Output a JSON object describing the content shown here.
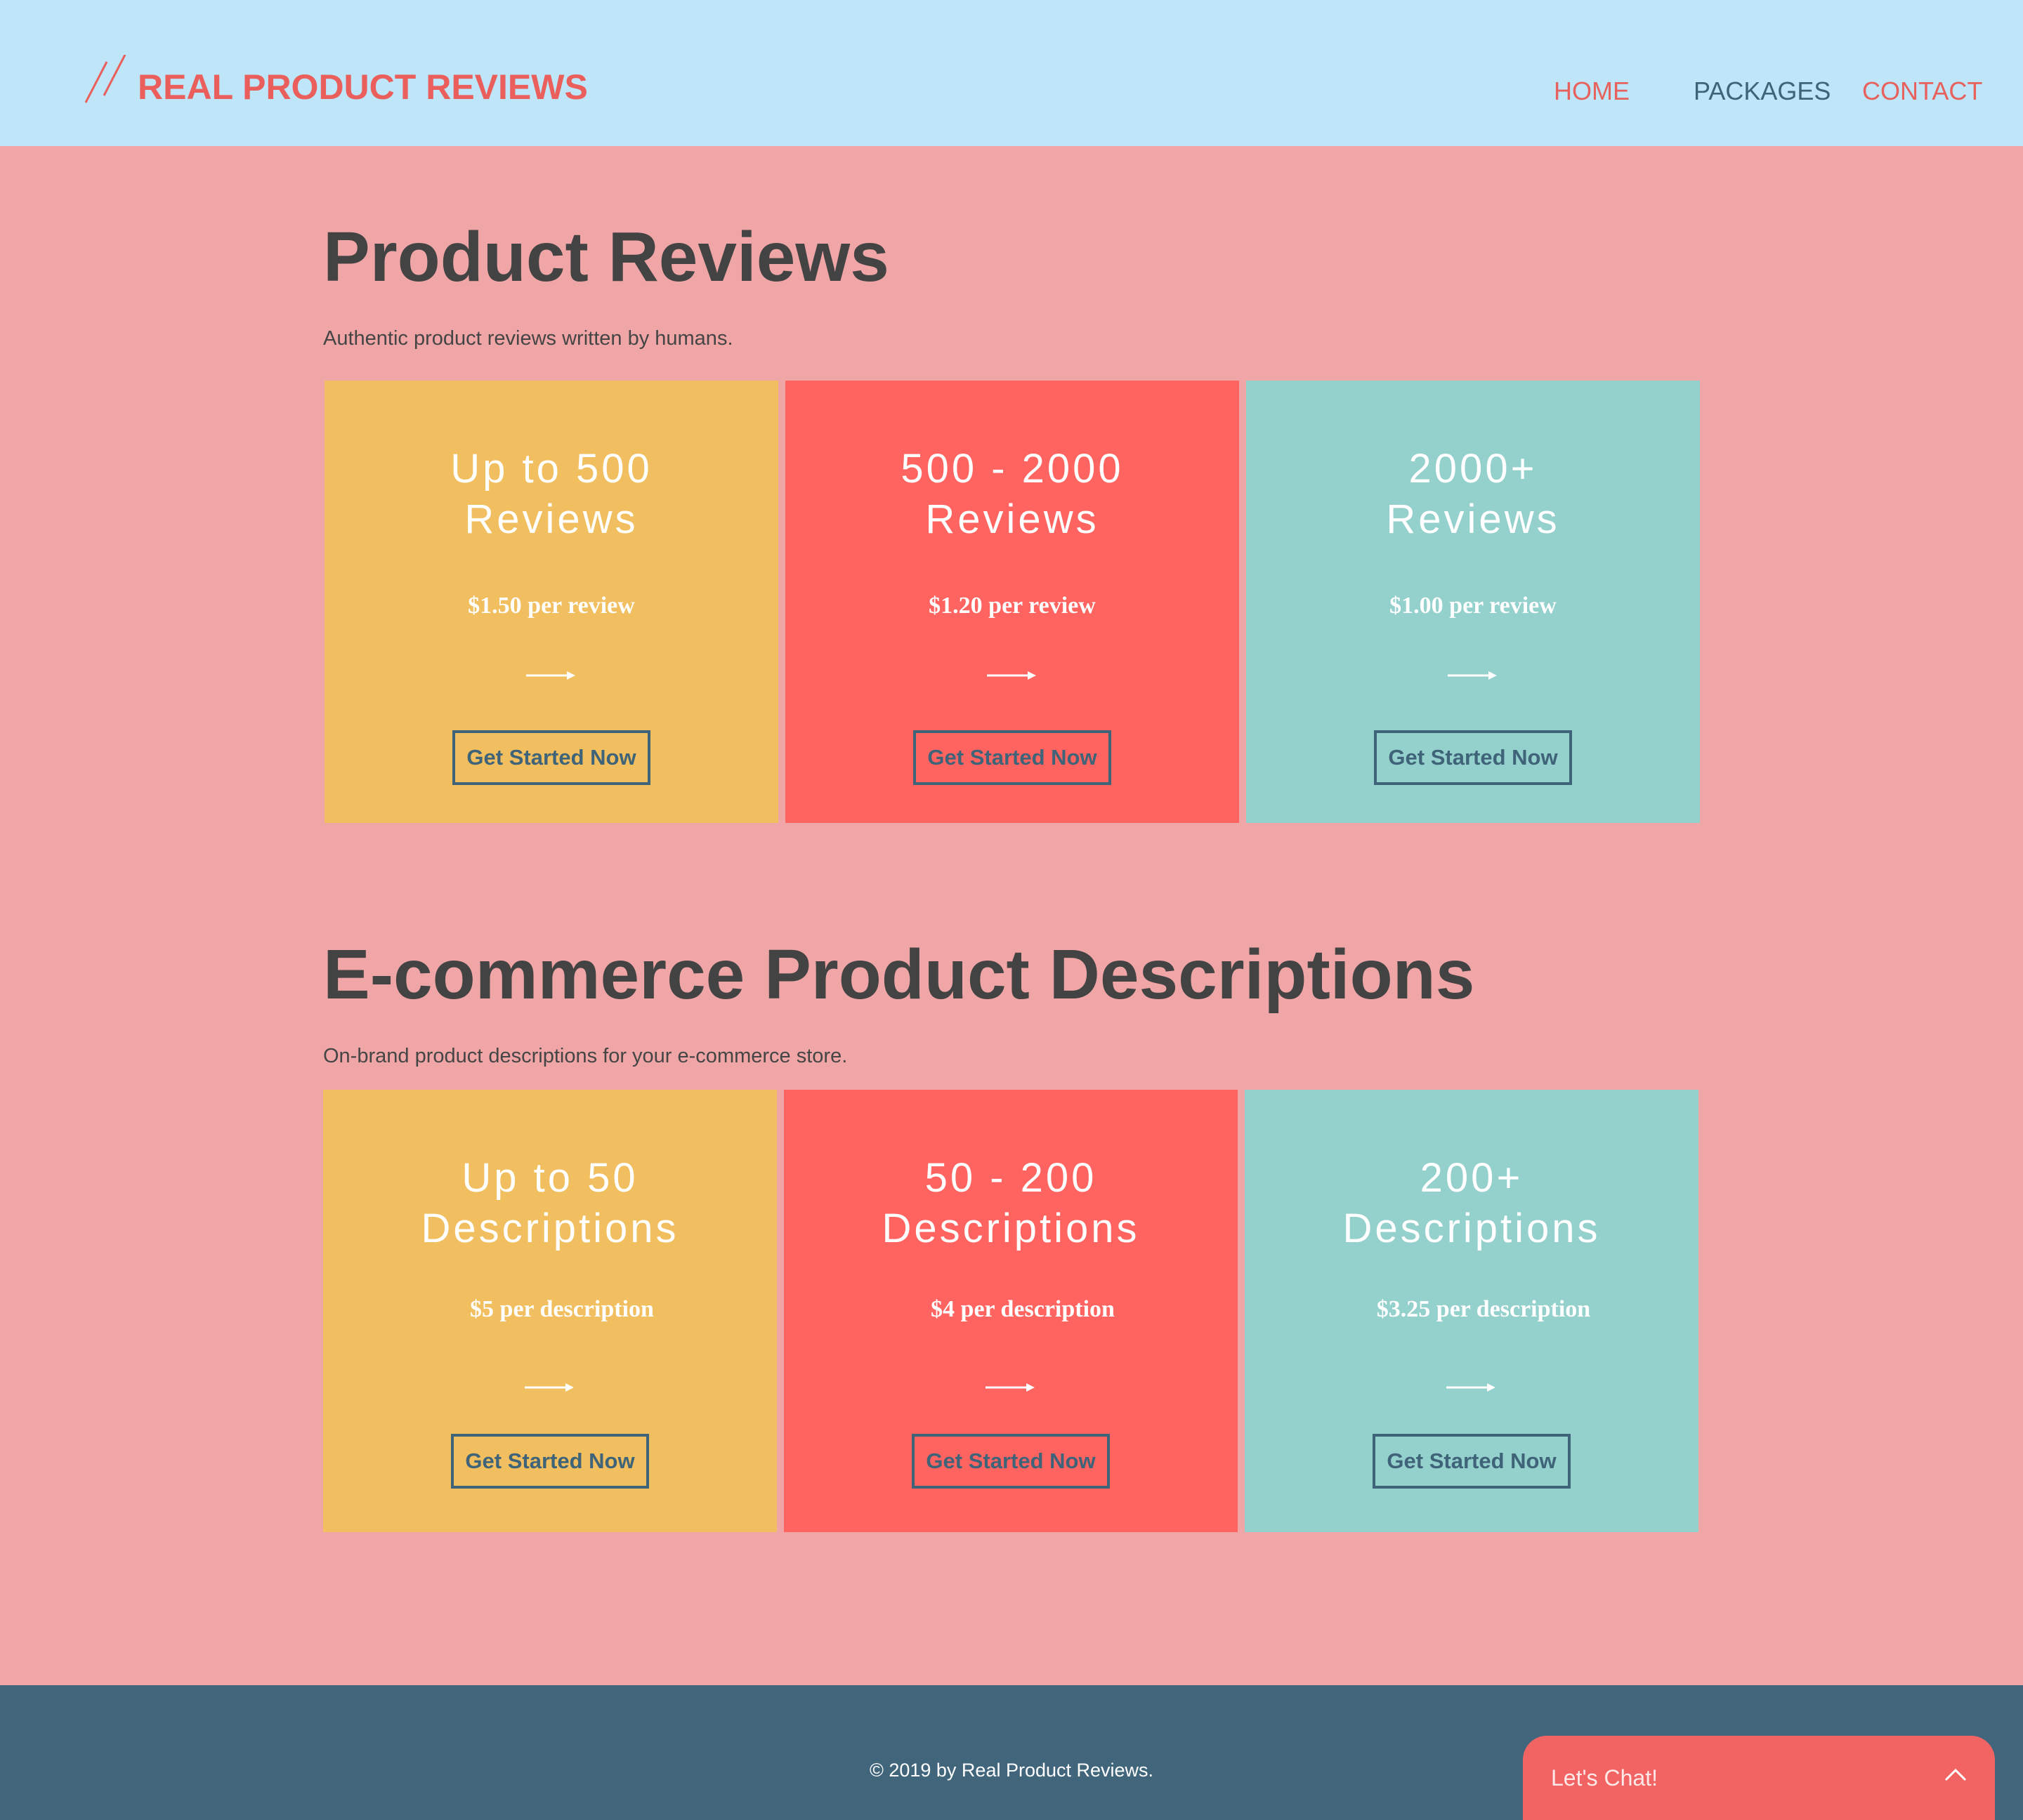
{
  "header": {
    "logo_text": "REAL PRODUCT REVIEWS",
    "nav": {
      "home": "HOME",
      "packages": "PACKAGES",
      "contact": "CONTACT"
    }
  },
  "reviews_section": {
    "title": "Product Reviews",
    "subtitle": "Authentic product reviews written by humans.",
    "cards": [
      {
        "title_line1": "Up to 500",
        "title_line2": "Reviews",
        "price": "$1.50 per review",
        "button": "Get Started Now"
      },
      {
        "title_line1": "500 - 2000",
        "title_line2": "Reviews",
        "price": "$1.20 per review",
        "button": "Get Started Now"
      },
      {
        "title_line1": "2000+",
        "title_line2": "Reviews",
        "price": "$1.00 per review",
        "button": "Get Started Now"
      }
    ]
  },
  "descriptions_section": {
    "title": "E-commerce Product Descriptions",
    "subtitle": "On-brand product descriptions for your e-commerce store.",
    "cards": [
      {
        "title_line1": "Up to 50",
        "title_line2": "Descriptions",
        "price": "$5 per description",
        "button": "Get Started Now"
      },
      {
        "title_line1": "50 - 200",
        "title_line2": "Descriptions",
        "price": "$4 per description",
        "button": "Get Started Now"
      },
      {
        "title_line1": "200+",
        "title_line2": "Descriptions",
        "price": "$3.25 per description",
        "button": "Get Started Now"
      }
    ]
  },
  "footer": {
    "copyright": "© 2019 by Real Product Reviews."
  },
  "chat": {
    "label": "Let's Chat!"
  },
  "icons": {
    "logo": "double-slash-logo-icon",
    "card_arrow": "arrow-right-icon",
    "chat_toggle": "chevron-up-icon"
  },
  "colors": {
    "header_bg": "#bfe5f9",
    "page_bg": "#f0a6a6",
    "accent_red": "#ea5f5b",
    "card_yellow": "#f1bf5f",
    "card_red": "#ff6461",
    "card_teal": "#94d0cc",
    "button_border": "#3f6378",
    "footer_bg": "#41667c",
    "heading": "#434343"
  }
}
